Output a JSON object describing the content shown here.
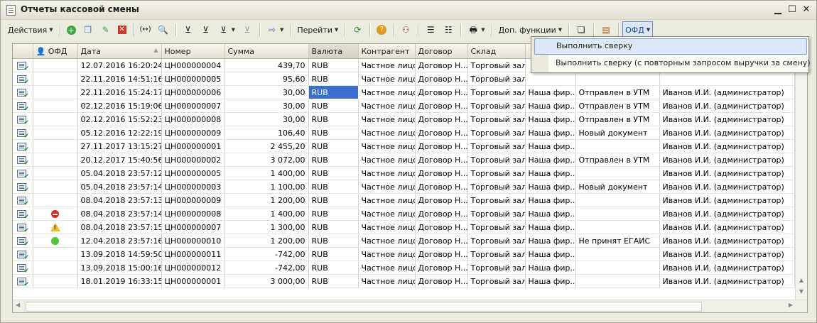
{
  "window": {
    "title": "Отчеты кассовой смены"
  },
  "toolbar": {
    "actions": "Действия",
    "goto": "Перейти",
    "extra": "Доп. функции",
    "ofd": "ОФД"
  },
  "columns": {
    "ofd": "ОФД",
    "date": "Дата",
    "number": "Номер",
    "sum": "Сумма",
    "currency": "Валюта",
    "counterparty": "Контрагент",
    "contract": "Договор",
    "warehouse": "Склад"
  },
  "menu": {
    "item1": "Выполнить сверку",
    "item2": "Выполнить сверку (с повторным запросом выручки за смену)"
  },
  "rows": [
    {
      "ofd": "",
      "date": "12.07.2016 16:20:24",
      "number": "ЦН000000004",
      "sum": "439,70",
      "currency": "RUB",
      "counterparty": "Частное лицо",
      "contract": "Договор Н...",
      "warehouse": "Торговый зал",
      "org": "",
      "status": "",
      "author": ""
    },
    {
      "ofd": "",
      "date": "22.11.2016 14:51:16",
      "number": "ЦН000000005",
      "sum": "95,60",
      "currency": "RUB",
      "counterparty": "Частное лицо",
      "contract": "Договор Н...",
      "warehouse": "Торговый зал",
      "org": "",
      "status": "",
      "author": ""
    },
    {
      "ofd": "",
      "date": "22.11.2016 15:24:17",
      "number": "ЦН000000006",
      "sum": "30,00",
      "currency": "RUB",
      "counterparty": "Частное лицо",
      "contract": "Договор Н...",
      "warehouse": "Торговый зал",
      "org": "Наша фир...",
      "status": "Отправлен в УТМ",
      "author": "Иванов И.И. (администратор)"
    },
    {
      "ofd": "",
      "date": "02.12.2016 15:19:06",
      "number": "ЦН000000007",
      "sum": "30,00",
      "currency": "RUB",
      "counterparty": "Частное лицо",
      "contract": "Договор Н...",
      "warehouse": "Торговый зал",
      "org": "Наша фир...",
      "status": "Отправлен в УТМ",
      "author": "Иванов И.И. (администратор)"
    },
    {
      "ofd": "",
      "date": "02.12.2016 15:52:23",
      "number": "ЦН000000008",
      "sum": "30,00",
      "currency": "RUB",
      "counterparty": "Частное лицо",
      "contract": "Договор Н...",
      "warehouse": "Торговый зал",
      "org": "Наша фир...",
      "status": "Отправлен в УТМ",
      "author": "Иванов И.И. (администратор)"
    },
    {
      "ofd": "",
      "date": "05.12.2016 12:22:19",
      "number": "ЦН000000009",
      "sum": "106,40",
      "currency": "RUB",
      "counterparty": "Частное лицо",
      "contract": "Договор Н...",
      "warehouse": "Торговый зал",
      "org": "Наша фир...",
      "status": "Новый документ",
      "author": "Иванов И.И. (администратор)"
    },
    {
      "ofd": "",
      "date": "27.11.2017 13:15:27",
      "number": "ЦН000000001",
      "sum": "2 455,20",
      "currency": "RUB",
      "counterparty": "Частное лицо",
      "contract": "Договор Н...",
      "warehouse": "Торговый зал",
      "org": "Наша фир...",
      "status": "",
      "author": "Иванов И.И. (администратор)"
    },
    {
      "ofd": "",
      "date": "20.12.2017 15:40:56",
      "number": "ЦН000000002",
      "sum": "3 072,00",
      "currency": "RUB",
      "counterparty": "Частное лицо",
      "contract": "Договор Н...",
      "warehouse": "Торговый зал",
      "org": "Наша фир...",
      "status": "Отправлен в УТМ",
      "author": "Иванов И.И. (администратор)"
    },
    {
      "ofd": "",
      "date": "05.04.2018 23:57:12",
      "number": "ЦН000000005",
      "sum": "1 400,00",
      "currency": "RUB",
      "counterparty": "Частное лицо",
      "contract": "Договор Н...",
      "warehouse": "Торговый зал",
      "org": "Наша фир...",
      "status": "",
      "author": "Иванов И.И. (администратор)"
    },
    {
      "ofd": "",
      "date": "05.04.2018 23:57:14",
      "number": "ЦН000000003",
      "sum": "1 100,00",
      "currency": "RUB",
      "counterparty": "Частное лицо",
      "contract": "Договор Н...",
      "warehouse": "Торговый зал",
      "org": "Наша фир...",
      "status": "Новый документ",
      "author": "Иванов И.И. (администратор)"
    },
    {
      "ofd": "",
      "date": "08.04.2018 23:57:13",
      "number": "ЦН000000009",
      "sum": "1 200,00",
      "currency": "RUB",
      "counterparty": "Частное лицо",
      "contract": "Договор Н...",
      "warehouse": "Торговый зал",
      "org": "Наша фир...",
      "status": "",
      "author": "Иванов И.И. (администратор)"
    },
    {
      "ofd": "error",
      "date": "08.04.2018 23:57:14",
      "number": "ЦН000000008",
      "sum": "1 400,00",
      "currency": "RUB",
      "counterparty": "Частное лицо",
      "contract": "Договор Н...",
      "warehouse": "Торговый зал",
      "org": "Наша фир...",
      "status": "",
      "author": "Иванов И.И. (администратор)"
    },
    {
      "ofd": "warning",
      "date": "08.04.2018 23:57:15",
      "number": "ЦН000000007",
      "sum": "1 300,00",
      "currency": "RUB",
      "counterparty": "Частное лицо",
      "contract": "Договор Н...",
      "warehouse": "Торговый зал",
      "org": "Наша фир...",
      "status": "",
      "author": "Иванов И.И. (администратор)"
    },
    {
      "ofd": "ok",
      "date": "12.04.2018 23:57:16",
      "number": "ЦН000000010",
      "sum": "1 200,00",
      "currency": "RUB",
      "counterparty": "Частное лицо",
      "contract": "Договор Н...",
      "warehouse": "Торговый зал",
      "org": "Наша фир...",
      "status": "Не принят ЕГАИС",
      "author": "Иванов И.И. (администратор)"
    },
    {
      "ofd": "",
      "date": "13.09.2018 14:59:50",
      "number": "ЦН000000011",
      "sum": "-742,00",
      "currency": "RUB",
      "counterparty": "Частное лицо",
      "contract": "Договор Н...",
      "warehouse": "Торговый зал",
      "org": "Наша фир...",
      "status": "",
      "author": "Иванов И.И. (администратор)"
    },
    {
      "ofd": "",
      "date": "13.09.2018 15:00:16",
      "number": "ЦН000000012",
      "sum": "-742,00",
      "currency": "RUB",
      "counterparty": "Частное лицо",
      "contract": "Договор Н...",
      "warehouse": "Торговый зал",
      "org": "Наша фир...",
      "status": "",
      "author": "Иванов И.И. (администратор)"
    },
    {
      "ofd": "",
      "date": "18.01.2019 16:33:15",
      "number": "ЦН000000001",
      "sum": "3 000,00",
      "currency": "RUB",
      "counterparty": "Частное лицо",
      "contract": "Договор Н...",
      "warehouse": "Торговый зал",
      "org": "Наша фир...",
      "status": "",
      "author": "Иванов И.И. (администратор)"
    }
  ]
}
